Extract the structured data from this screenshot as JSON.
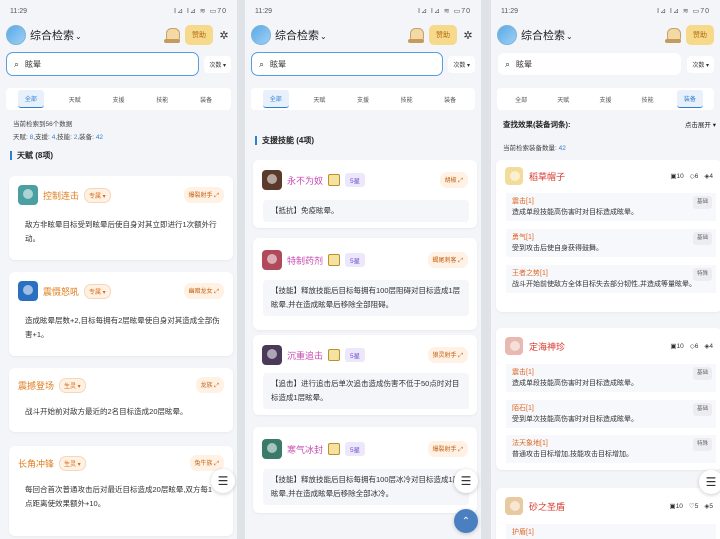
{
  "status": {
    "time": "11:29",
    "icons": "ⵏ⊿ ⵏ⊿ ≋ ▭70"
  },
  "app": {
    "title": "综合检索",
    "donate": "赞助"
  },
  "sort_label": "次数 ▾",
  "tabs": [
    "全部",
    "天赋",
    "支援",
    "技能",
    "装备"
  ],
  "panel1": {
    "query": "眩晕",
    "stats_line1": "当前检索到56个数据",
    "stats_line2": {
      "talent_label": "天赋:",
      "talent": "8",
      "support_label": ",支援:",
      "support": "4",
      "skill_label": ",技能:",
      "skill": "2",
      "equip_label": ",装备:",
      "equip": "42"
    },
    "section": "天赋 (8项)",
    "cards": [
      {
        "name": "控制连击",
        "badge": "专属 ▾",
        "role": "爆裂射手",
        "desc": "敌方非眩晕目标受到眩晕后使自身对其立即进行1次额外行动。",
        "img_color": "#4aa0a0"
      },
      {
        "name": "震慑怒吼",
        "badge": "专属 ▾",
        "role": "幽暗龙女",
        "desc": "造成眩晕层数+2,目标每拥有2层眩晕使自身对其造成全部伤害+1。",
        "img_color": "#2a6fc2"
      },
      {
        "name": "震撼登场",
        "badge": "生灵 ▾",
        "role": "龙族",
        "desc": "战斗开始前对敌方最近的2名目标造成20层眩晕。"
      },
      {
        "name": "长角冲锋",
        "badge": "生灵 ▾",
        "role": "兔牛族",
        "desc": "每回合首次普通攻击后对最近目标造成20层眩晕,双方每1点距离使效果额外+10。"
      }
    ]
  },
  "panel2": {
    "query": "眩晕",
    "section": "支援技能 (4项)",
    "cards": [
      {
        "name": "永不为奴",
        "star": "5星",
        "role": "胡椒",
        "desc": "【抵抗】免疫眩晕。",
        "img_color": "#5a3a2a"
      },
      {
        "name": "特制药剂",
        "star": "5星",
        "role": "蝎尾刺客",
        "desc": "【技能】释放技能后目标每拥有100层阻碍对目标造成1层眩晕,并在造成眩晕后移除全部阻碍。",
        "img_color": "#b04a5a"
      },
      {
        "name": "沉重追击",
        "star": "5星",
        "role": "狼灵射手",
        "desc": "【追击】进行追击后单次追击造成伤害不低于50点时对目标造成1层眩晕。",
        "img_color": "#4a3a5a"
      },
      {
        "name": "寒气冰封",
        "star": "5星",
        "role": "爆裂射手",
        "desc": "【技能】释放技能后目标每拥有100层冰冷对目标造成1层眩晕,并在造成眩晕后移除全部冰冷。",
        "img_color": "#3a7a6a"
      }
    ]
  },
  "panel3": {
    "query": "眩晕",
    "filter_label": "查找效果(装备词条):",
    "expand": "点击展开 ▾",
    "count_label": "当前检索装备数量:",
    "count": "42",
    "items": [
      {
        "name": "稻草帽子",
        "c1": "10",
        "c2": "6",
        "c3": "4",
        "effects": [
          {
            "n": "震击[1]",
            "t": "造成单段技能高伤害时对目标造成眩晕。",
            "b": "基础"
          },
          {
            "n": "勇气[1]",
            "t": "受到攻击后使自身获得鼓舞。",
            "b": "基础"
          },
          {
            "n": "王者之势[1]",
            "t": "战斗开始前使敌方全体目标失去部分韧性,并造成等量眩晕。",
            "b": "特殊"
          }
        ]
      },
      {
        "name": "定海神珍",
        "c1": "10",
        "c2": "6",
        "c3": "4",
        "effects": [
          {
            "n": "震击[1]",
            "t": "造成单段技能高伤害时对目标造成眩晕。",
            "b": "基础"
          },
          {
            "n": "陌石[1]",
            "t": "受到单次技能高伤害时对目标造成眩晕。",
            "b": "基础"
          },
          {
            "n": "法天象地[1]",
            "t": "普通攻击目标增加,技能攻击目标增加。",
            "b": "特殊"
          }
        ]
      },
      {
        "name": "砂之圣盾",
        "c1": "10",
        "c2": "5",
        "c3": "5",
        "effects": [
          {
            "n": "护盾[1]",
            "t": "",
            "b": ""
          }
        ]
      }
    ]
  }
}
